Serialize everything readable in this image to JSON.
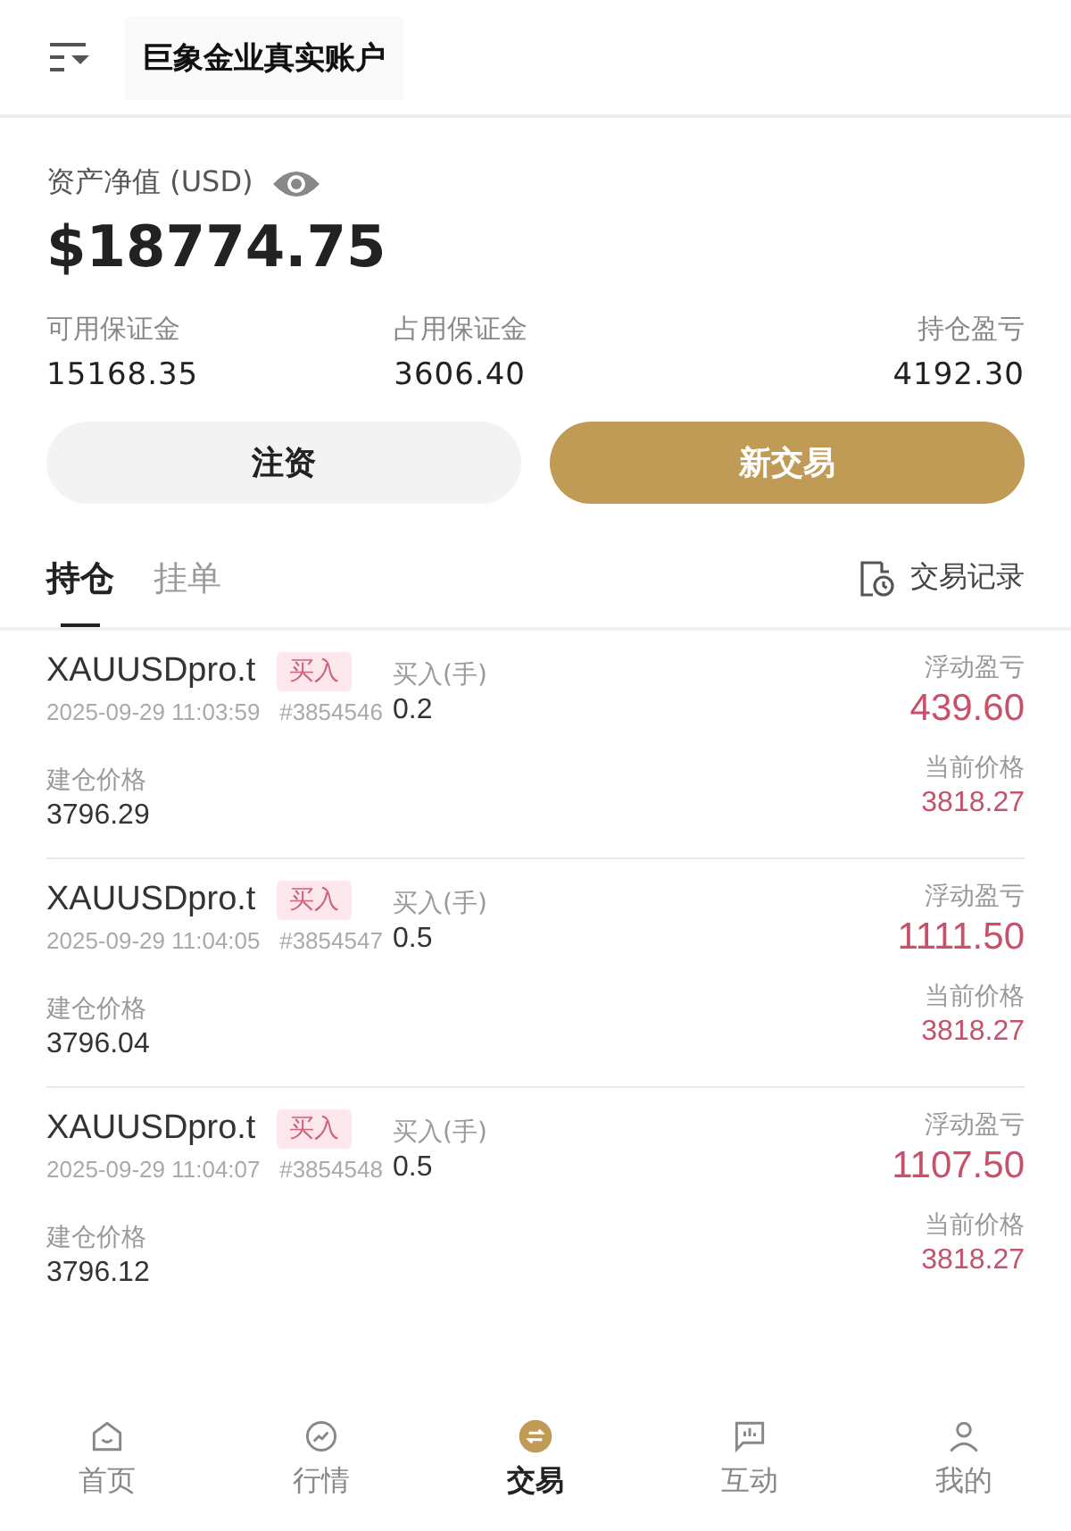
{
  "header": {
    "title": "巨象金业真实账户"
  },
  "account": {
    "equity_label": "资产净值 (USD)",
    "equity": "$18774.75",
    "stats": [
      {
        "label": "可用保证金",
        "value": "15168.35"
      },
      {
        "label": "占用保证金",
        "value": "3606.40"
      },
      {
        "label": "持仓盈亏",
        "value": "4192.30"
      }
    ]
  },
  "actions": [
    {
      "label": "注资",
      "kind": "secondary"
    },
    {
      "label": "新交易",
      "kind": "primary"
    }
  ],
  "tabs": [
    {
      "label": "持仓",
      "selected": true
    },
    {
      "label": "挂单",
      "selected": false
    }
  ],
  "history_link": "交易记录",
  "positions": [
    {
      "symbol": "XAUUSDpro.t",
      "side": "买入",
      "time": "2025-09-29 11:03:59",
      "order": "#3854546",
      "volume_label": "买入(手)",
      "volume": "0.2",
      "pnl_label": "浮动盈亏",
      "pnl": "439.60",
      "open_label": "建仓价格",
      "open_price": "3796.29",
      "current_label": "当前价格",
      "current_price": "3818.27"
    },
    {
      "symbol": "XAUUSDpro.t",
      "side": "买入",
      "time": "2025-09-29 11:04:05",
      "order": "#3854547",
      "volume_label": "买入(手)",
      "volume": "0.5",
      "pnl_label": "浮动盈亏",
      "pnl": "1111.50",
      "open_label": "建仓价格",
      "open_price": "3796.04",
      "current_label": "当前价格",
      "current_price": "3818.27"
    },
    {
      "symbol": "XAUUSDpro.t",
      "side": "买入",
      "time": "2025-09-29 11:04:07",
      "order": "#3854548",
      "volume_label": "买入(手)",
      "volume": "0.5",
      "pnl_label": "浮动盈亏",
      "pnl": "1107.50",
      "open_label": "建仓价格",
      "open_price": "3796.12",
      "current_label": "当前价格",
      "current_price": "3818.27"
    }
  ],
  "nav": [
    {
      "label": "首页",
      "kind": "home",
      "selected": false
    },
    {
      "label": "行情",
      "kind": "market",
      "selected": false
    },
    {
      "label": "交易",
      "kind": "trade",
      "selected": true
    },
    {
      "label": "互动",
      "kind": "chat",
      "selected": false
    },
    {
      "label": "我的",
      "kind": "profile",
      "selected": false
    }
  ]
}
